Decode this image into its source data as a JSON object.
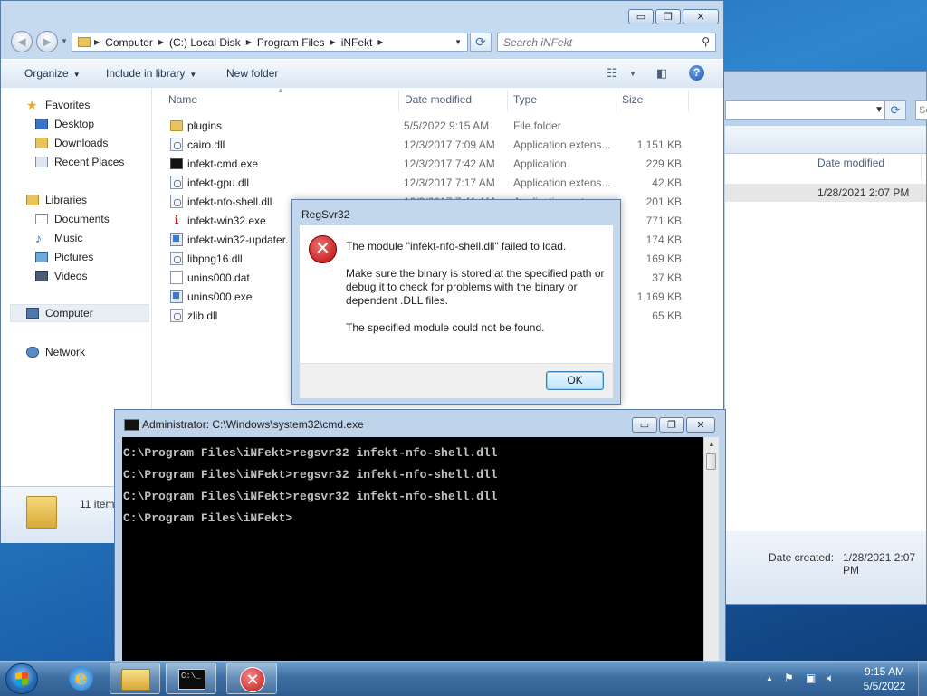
{
  "background_window": {
    "search_placeholder": "Se",
    "column_date_modified": "Date modified",
    "row_date": "1/28/2021 2:07 PM",
    "date_created_label": "Date created:",
    "date_created_value": "1/28/2021 2:07 PM"
  },
  "explorer": {
    "title_buttons": {
      "minimize": "▭",
      "maximize": "❐",
      "close": "✕"
    },
    "breadcrumb": [
      "Computer",
      "(C:) Local Disk",
      "Program Files",
      "iNFekt"
    ],
    "search_placeholder": "Search iNFekt",
    "toolbar": {
      "organize": "Organize",
      "include_in_library": "Include in library",
      "new_folder": "New folder"
    },
    "nav": {
      "favorites": "Favorites",
      "desktop": "Desktop",
      "downloads": "Downloads",
      "recent_places": "Recent Places",
      "libraries": "Libraries",
      "documents": "Documents",
      "music": "Music",
      "pictures": "Pictures",
      "videos": "Videos",
      "computer": "Computer",
      "network": "Network"
    },
    "columns": {
      "name": "Name",
      "date_modified": "Date modified",
      "type": "Type",
      "size": "Size"
    },
    "files": [
      {
        "name": "plugins",
        "date": "5/5/2022 9:15 AM",
        "type": "File folder",
        "size": "",
        "icon": "folder"
      },
      {
        "name": "cairo.dll",
        "date": "12/3/2017 7:09 AM",
        "type": "Application extens...",
        "size": "1,151 KB",
        "icon": "dll"
      },
      {
        "name": "infekt-cmd.exe",
        "date": "12/3/2017 7:42 AM",
        "type": "Application",
        "size": "229 KB",
        "icon": "cmd"
      },
      {
        "name": "infekt-gpu.dll",
        "date": "12/3/2017 7:17 AM",
        "type": "Application extens...",
        "size": "42 KB",
        "icon": "dll"
      },
      {
        "name": "infekt-nfo-shell.dll",
        "date": "12/3/2017 7:41 AM",
        "type": "Application extens...",
        "size": "201 KB",
        "icon": "dll"
      },
      {
        "name": "infekt-win32.exe",
        "date": "",
        "type": "",
        "size": "771 KB",
        "icon": "info"
      },
      {
        "name": "infekt-win32-updater.",
        "date": "",
        "type": "",
        "size": "174 KB",
        "icon": "exe"
      },
      {
        "name": "libpng16.dll",
        "date": "",
        "type": "",
        "size": "169 KB",
        "icon": "dll"
      },
      {
        "name": "unins000.dat",
        "date": "",
        "type": "",
        "size": "37 KB",
        "icon": "dat"
      },
      {
        "name": "unins000.exe",
        "date": "",
        "type": "",
        "size": "1,169 KB",
        "icon": "exe"
      },
      {
        "name": "zlib.dll",
        "date": "",
        "type": "",
        "size": "65 KB",
        "icon": "dll"
      }
    ],
    "status": "11 item"
  },
  "dialog": {
    "title": "RegSvr32",
    "message_1": "The module \"infekt-nfo-shell.dll\" failed to load.",
    "message_2": "Make sure the binary is stored at the specified path or debug it to check for problems with the binary or dependent .DLL files.",
    "message_3": "The specified module could not be found.",
    "ok_label": "OK"
  },
  "cmd": {
    "title": "Administrator: C:\\Windows\\system32\\cmd.exe",
    "lines": [
      "C:\\Program Files\\iNFekt>regsvr32 infekt-nfo-shell.dll",
      "C:\\Program Files\\iNFekt>regsvr32 infekt-nfo-shell.dll",
      "C:\\Program Files\\iNFekt>regsvr32 infekt-nfo-shell.dll",
      "C:\\Program Files\\iNFekt>"
    ]
  },
  "taskbar": {
    "time": "9:15 AM",
    "date": "5/5/2022",
    "cmd_icon_text": "C:\\_"
  }
}
